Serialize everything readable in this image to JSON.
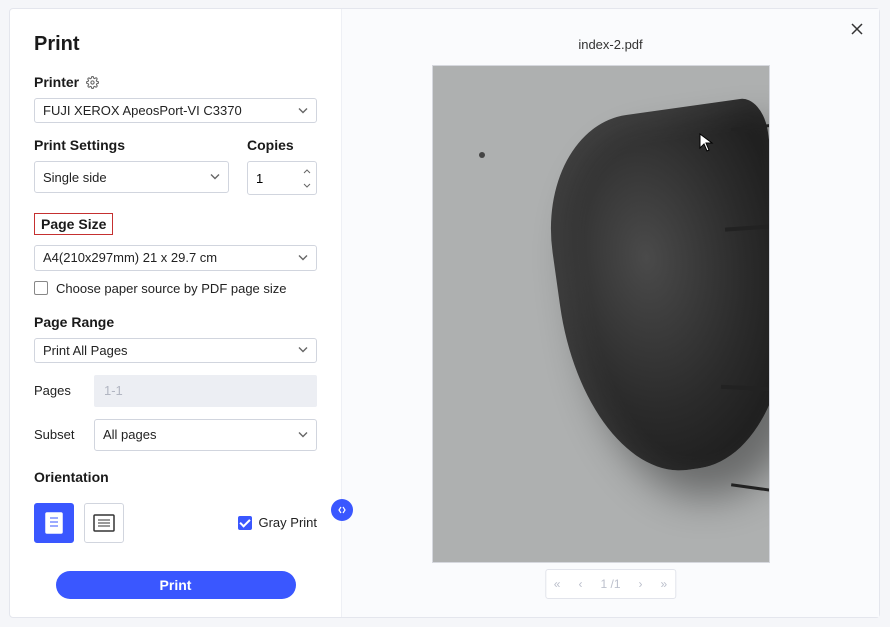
{
  "title": "Print",
  "printer": {
    "label": "Printer",
    "value": "FUJI XEROX ApeosPort-VI C3370"
  },
  "printSettings": {
    "label": "Print Settings",
    "value": "Single side"
  },
  "copies": {
    "label": "Copies",
    "value": "1"
  },
  "pageSize": {
    "label": "Page Size",
    "value": "A4(210x297mm) 21 x 29.7 cm"
  },
  "paperSourceCheckbox": {
    "label": "Choose paper source by PDF page size"
  },
  "pageRange": {
    "label": "Page Range",
    "value": "Print All Pages"
  },
  "pagesField": {
    "label": "Pages",
    "placeholder": "1-1"
  },
  "subset": {
    "label": "Subset",
    "value": "All pages"
  },
  "orientation": {
    "label": "Orientation"
  },
  "grayPrint": {
    "label": "Gray Print"
  },
  "printButton": "Print",
  "preview": {
    "filename": "index-2.pdf",
    "current": "1",
    "total": "/1"
  }
}
